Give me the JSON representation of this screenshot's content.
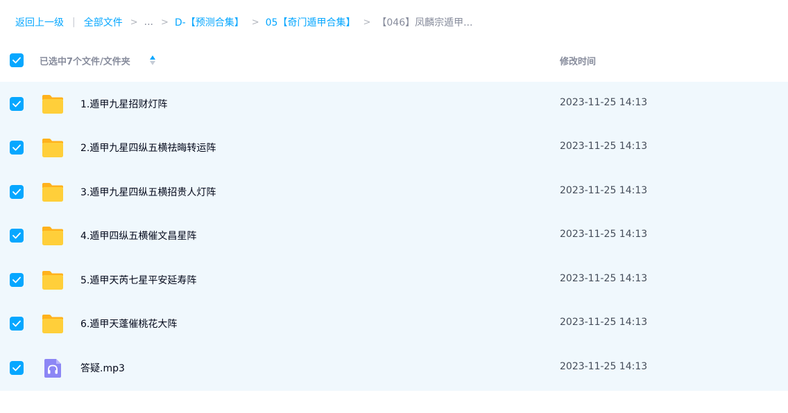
{
  "breadcrumb": {
    "back": "返回上一级",
    "separator": "|",
    "items": [
      "全部文件",
      "...",
      "D-【预测合集】",
      "05【奇门遁甲合集】"
    ],
    "current": "【046】凤麟宗遁甲..."
  },
  "header": {
    "selection_label": "已选中7个文件/文件夹",
    "time_column": "修改时间",
    "all_checked": true
  },
  "colors": {
    "accent": "#06a7ff",
    "list_bg": "#f0f8fd",
    "folder": "#ffc933"
  },
  "files": [
    {
      "name": "1.遁甲九星招财灯阵",
      "time": "2023-11-25 14:13",
      "type": "folder",
      "checked": true
    },
    {
      "name": "2.遁甲九星四纵五横祛晦转运阵",
      "time": "2023-11-25 14:13",
      "type": "folder",
      "checked": true
    },
    {
      "name": "3.遁甲九星四纵五横招贵人灯阵",
      "time": "2023-11-25 14:13",
      "type": "folder",
      "checked": true
    },
    {
      "name": "4.遁甲四纵五横催文昌星阵",
      "time": "2023-11-25 14:13",
      "type": "folder",
      "checked": true
    },
    {
      "name": "5.遁甲天芮七星平安延寿阵",
      "time": "2023-11-25 14:13",
      "type": "folder",
      "checked": true
    },
    {
      "name": "6.遁甲天蓬催桃花大阵",
      "time": "2023-11-25 14:13",
      "type": "folder",
      "checked": true
    },
    {
      "name": "答疑.mp3",
      "time": "2023-11-25 14:13",
      "type": "audio",
      "checked": true
    }
  ]
}
